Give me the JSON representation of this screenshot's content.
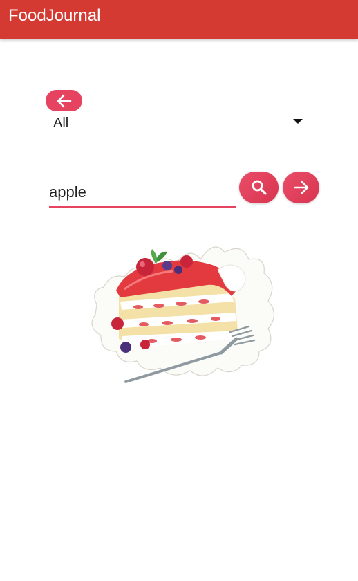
{
  "app": {
    "title": "FoodJournal"
  },
  "colors": {
    "appbar": "#d43a32",
    "accent": "#e5435f"
  },
  "back_button": {
    "icon": "arrow-left-icon"
  },
  "category_dropdown": {
    "selected": "All",
    "icon": "caret-down-icon"
  },
  "search": {
    "value": "apple",
    "search_icon": "search-icon",
    "forward_icon": "arrow-right-icon"
  },
  "image": {
    "subject": "cake-slice-illustration"
  }
}
